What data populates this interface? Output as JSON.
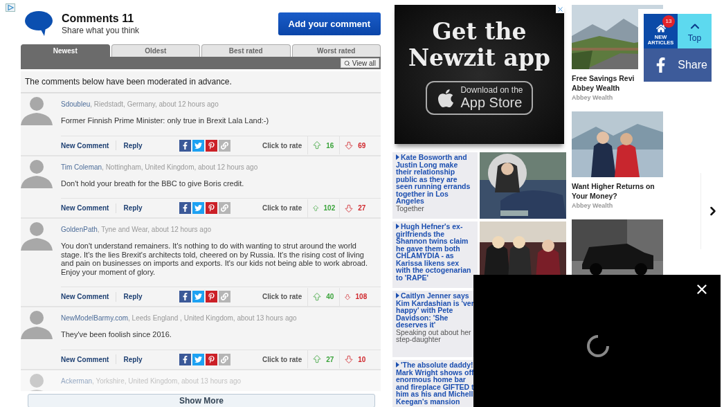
{
  "comments_header": {
    "title": "Comments 11",
    "subtitle": "Share what you think",
    "add_button": "Add your comment"
  },
  "tabs": [
    {
      "label": "Newest",
      "selected": true
    },
    {
      "label": "Oldest",
      "selected": false
    },
    {
      "label": "Best rated",
      "selected": false
    },
    {
      "label": "Worst rated",
      "selected": false
    }
  ],
  "view_all": "View all",
  "notice": "The comments below have been moderated in advance.",
  "comments": [
    {
      "faded": false,
      "author": "Sdoubleu",
      "meta": ", Riedstadt, Germany, about 12 hours ago",
      "body": "Former Finnish Prime Minister: only true in Brexit Lala Land:-)",
      "new_comment": "New Comment",
      "reply": "Reply",
      "rate_label": "Click to rate",
      "up": "16",
      "down": "69"
    },
    {
      "faded": false,
      "author": "Tim Coleman",
      "meta": ", Nottingham, United Kingdom, about 12 hours ago",
      "body": "Don't hold your breath for the BBC to give Boris credit.",
      "new_comment": "New Comment",
      "reply": "Reply",
      "rate_label": "Click to rate",
      "up": "102",
      "down": "27"
    },
    {
      "faded": false,
      "author": "GoldenPath",
      "meta": ", Tyne and Wear, about 12 hours ago",
      "body": "You don't understand remainers. It's nothing to do with wanting to strut around the world stage. It's the lies Brexit's architects told, cheered on by Russia. It's the rising cost of living and pain on businesses on imports and exports. It's our kids not being able to work abroad. Enjoy your moment of glory.",
      "new_comment": "New Comment",
      "reply": "Reply",
      "rate_label": "Click to rate",
      "up": "40",
      "down": "108"
    },
    {
      "faded": false,
      "author": "NewModelBarmy.com",
      "meta": ", Leeds England , United Kingdom, about 13 hours ago",
      "body": "They've been foolish since 2016.",
      "new_comment": "New Comment",
      "reply": "Reply",
      "rate_label": "Click to rate",
      "up": "27",
      "down": "10"
    },
    {
      "faded": true,
      "author": "Ackerman",
      "meta": ", Yorkshire, United Kingdom, about 13 hours ago"
    }
  ],
  "show_more": "Show More",
  "ad": {
    "headline": "Get the Newzit app",
    "store_top": "Download on the",
    "store_name": "App Store"
  },
  "news": [
    {
      "headline": "Kate Bosworth and Justin Long make their relationship public as they are seen running errands together in Los Angeles",
      "summary": "Together"
    },
    {
      "headline": "Hugh Hefner's ex-girlfriends the Shannon twins claim he gave them both CHLAMYDIA - as Karissa likens sex with the octogenarian to 'RAPE'"
    },
    {
      "headline": "Caitlyn Jenner says Kim Kardashian is 'ver happy' with Pete Davidson: 'She deserves it'",
      "summary": "Speaking out about her step-daughter"
    },
    {
      "headline": "'The absolute daddy! Mark Wright shows off enormous home bar and fireplace GIFTED t him as his and Michell Keegan's mansion"
    }
  ],
  "sponsored": [
    {
      "kind": "card",
      "title_lines": [
        "Free Savings Revi",
        "Abbey Wealth"
      ],
      "source": "Abbey Wealth"
    },
    {
      "kind": "card",
      "title_lines": [
        "Want Higher Returns on",
        "Your Money?"
      ],
      "source": "Abbey Wealth"
    },
    {
      "kind": "picture"
    }
  ],
  "floating": {
    "badge": "13",
    "new_label": "NEW ARTICLES",
    "top": "Top",
    "share": "Share"
  },
  "video_overlay": {
    "loading": true
  }
}
